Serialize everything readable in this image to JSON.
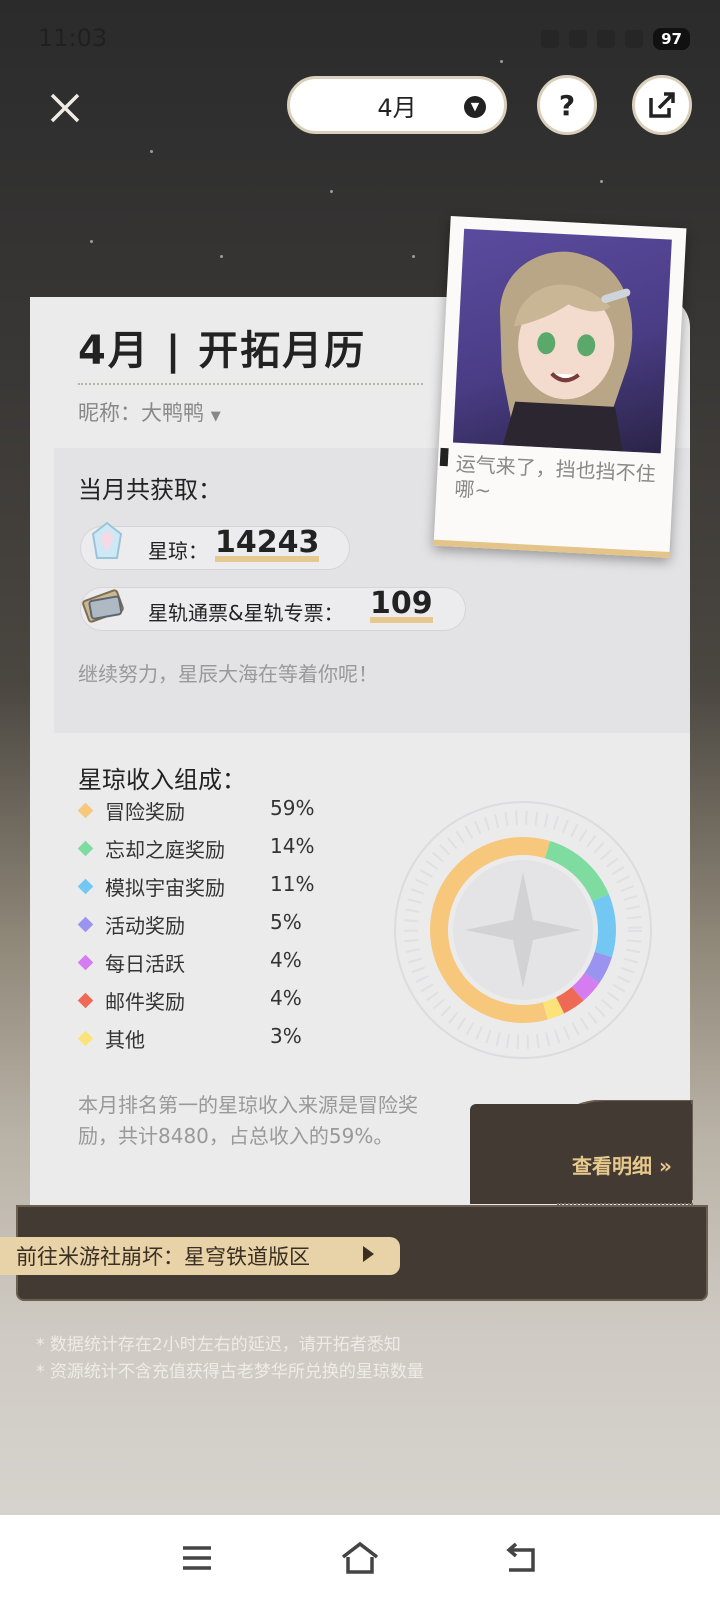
{
  "status_bar": {
    "time": "11:03",
    "battery": "97"
  },
  "header": {
    "month_selector": "4月",
    "help_icon": "question-icon",
    "share_icon": "share-icon",
    "close_icon": "close-icon"
  },
  "calendar": {
    "title": "4月 | 开拓月历",
    "nickname_label": "昵称：大鸭鸭",
    "photo_quote": "运气来了，挡也挡不住哪~"
  },
  "earnings": {
    "title": "当月共获取：",
    "items": [
      {
        "label": "星琼：",
        "value": "14243",
        "icon": "stellar-jade-icon"
      },
      {
        "label": "星轨通票&星轨专票：",
        "value": "109",
        "icon": "star-rail-pass-icon"
      }
    ],
    "encouragement": "继续努力，星辰大海在等着你呢！"
  },
  "income": {
    "title": "星琼收入组成：",
    "rows": [
      {
        "name": "冒险奖励",
        "pct": "59%",
        "color": "#f7c77c"
      },
      {
        "name": "忘却之庭奖励",
        "pct": "14%",
        "color": "#7fdca0"
      },
      {
        "name": "模拟宇宙奖励",
        "pct": "11%",
        "color": "#72c8f2"
      },
      {
        "name": "活动奖励",
        "pct": "5%",
        "color": "#9a94f0"
      },
      {
        "name": "每日活跃",
        "pct": "4%",
        "color": "#d57cf0"
      },
      {
        "name": "邮件奖励",
        "pct": "4%",
        "color": "#ee6a55"
      },
      {
        "name": "其他",
        "pct": "3%",
        "color": "#fbe37a"
      }
    ],
    "note": "本月排名第一的星琼收入来源是冒险奖励，共计8480，占总收入的59%。"
  },
  "chart_data": {
    "type": "pie",
    "categories": [
      "冒险奖励",
      "忘却之庭奖励",
      "模拟宇宙奖励",
      "活动奖励",
      "每日活跃",
      "邮件奖励",
      "其他"
    ],
    "values": [
      59,
      14,
      11,
      5,
      4,
      4,
      3
    ],
    "colors": [
      "#f7c77c",
      "#7fdca0",
      "#72c8f2",
      "#9a94f0",
      "#d57cf0",
      "#ee6a55",
      "#fbe37a"
    ]
  },
  "actions": {
    "view_details": "查看明细 »",
    "forum_link": "前往米游社崩坏：星穹铁道版区"
  },
  "footnotes": [
    "* 数据统计存在2小时左右的延迟，请开拓者悉知",
    "* 资源统计不含充值获得古老梦华所兑换的星琼数量"
  ],
  "nav_bar": {
    "menu_icon": "menu-icon",
    "home_icon": "home-icon",
    "back_icon": "back-icon"
  }
}
